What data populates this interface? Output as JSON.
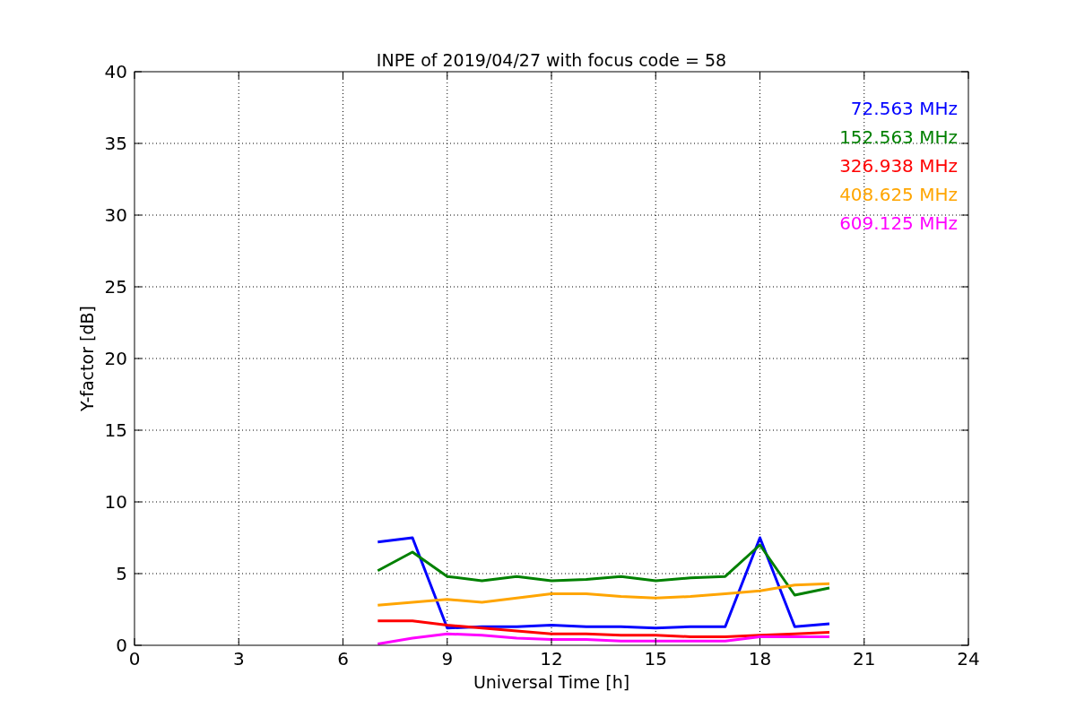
{
  "figure": {
    "chart_data": {
      "type": "line",
      "title": "INPE of 2019/04/27 with focus code = 58",
      "xlabel": "Universal Time [h]",
      "ylabel": "Y-factor [dB]",
      "x": [
        7,
        8,
        9,
        10,
        11,
        12,
        13,
        14,
        15,
        16,
        17,
        18,
        19,
        20
      ],
      "series": [
        {
          "name": "72.563 MHz",
          "color": "#0000ff",
          "values": [
            7.2,
            7.5,
            1.2,
            1.3,
            1.3,
            1.4,
            1.3,
            1.3,
            1.2,
            1.3,
            1.3,
            7.5,
            1.3,
            1.5
          ]
        },
        {
          "name": "152.563 MHz",
          "color": "#008000",
          "values": [
            5.2,
            6.5,
            4.8,
            4.5,
            4.8,
            4.5,
            4.6,
            4.8,
            4.5,
            4.7,
            4.8,
            7.0,
            3.5,
            4.0
          ]
        },
        {
          "name": "326.938 MHz",
          "color": "#ff0000",
          "values": [
            1.7,
            1.7,
            1.4,
            1.2,
            1.0,
            0.8,
            0.8,
            0.7,
            0.7,
            0.6,
            0.6,
            0.7,
            0.8,
            0.9
          ]
        },
        {
          "name": "408.625 MHz",
          "color": "#ffa500",
          "values": [
            2.8,
            3.0,
            3.2,
            3.0,
            3.3,
            3.6,
            3.6,
            3.4,
            3.3,
            3.4,
            3.6,
            3.8,
            4.2,
            4.3
          ]
        },
        {
          "name": "609.125 MHz",
          "color": "#ff00ff",
          "values": [
            0.1,
            0.5,
            0.8,
            0.7,
            0.5,
            0.4,
            0.4,
            0.3,
            0.3,
            0.3,
            0.3,
            0.6,
            0.6,
            0.6
          ]
        }
      ],
      "xlim": [
        0,
        24
      ],
      "ylim": [
        0,
        40
      ],
      "xticks": [
        0,
        3,
        6,
        9,
        12,
        15,
        18,
        21,
        24
      ],
      "yticks": [
        0,
        5,
        10,
        15,
        20,
        25,
        30,
        35,
        40
      ],
      "grid": true
    }
  }
}
